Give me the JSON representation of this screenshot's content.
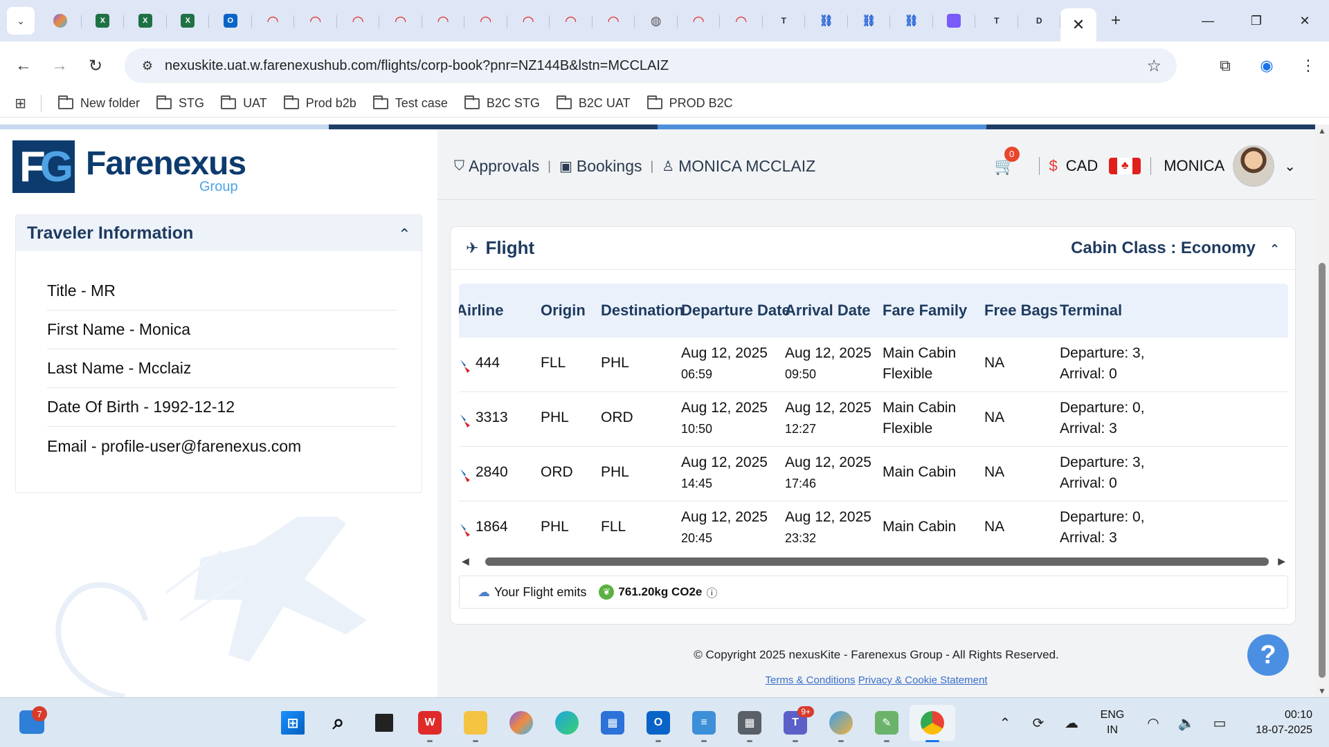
{
  "browser": {
    "tabs": [
      {
        "icon": "copilot-icon",
        "active": false
      },
      {
        "icon": "excel-icon",
        "label": "X",
        "active": false
      },
      {
        "icon": "excel-icon",
        "label": "X",
        "active": false
      },
      {
        "icon": "excel-icon",
        "label": "X",
        "active": false
      },
      {
        "icon": "outlook-icon",
        "label": "O",
        "active": false
      },
      {
        "icon": "arch-icon",
        "active": false
      },
      {
        "icon": "arch-icon",
        "active": false
      },
      {
        "icon": "arch-icon",
        "active": false
      },
      {
        "icon": "arch-icon",
        "active": false
      },
      {
        "icon": "arch-icon",
        "active": false
      },
      {
        "icon": "arch-icon",
        "active": false
      },
      {
        "icon": "arch-icon",
        "active": false
      },
      {
        "icon": "arch-icon",
        "active": false
      },
      {
        "icon": "arch-icon",
        "active": false
      },
      {
        "icon": "globe-icon",
        "active": false
      },
      {
        "icon": "arch-icon",
        "active": false
      },
      {
        "icon": "arch-icon",
        "active": false
      },
      {
        "icon": "t-icon",
        "label": "T",
        "active": false
      },
      {
        "icon": "link-icon",
        "active": false
      },
      {
        "icon": "link-icon",
        "active": false
      },
      {
        "icon": "link-icon",
        "active": false
      },
      {
        "icon": "purple-icon",
        "active": false
      },
      {
        "icon": "t-icon",
        "label": "T",
        "active": false
      },
      {
        "icon": "d-icon",
        "label": "D",
        "active": false
      }
    ],
    "url": "nexuskite.uat.w.farenexushub.com/flights/corp-book?pnr=NZ144B&lstn=MCCLAIZ",
    "bookmarks": [
      "New folder",
      "STG",
      "UAT",
      "Prod b2b",
      "Test case",
      "B2C STG",
      "B2C UAT",
      "PROD B2C"
    ]
  },
  "logo": {
    "mark": "FG",
    "name": "Farenexus",
    "group": "Group"
  },
  "traveler": {
    "title": "Traveler Information",
    "rows": [
      "Title - MR",
      "First Name - Monica",
      "Last Name - Mcclaiz",
      "Date Of Birth - 1992-12-12",
      "Email - profile-user@farenexus.com"
    ]
  },
  "header": {
    "approvals": "Approvals",
    "bookings": "Bookings",
    "traveler_name": "MONICA MCCLAIZ",
    "cart_count": "0",
    "currency_symbol": "$",
    "currency": "CAD",
    "user": "MONICA"
  },
  "flight": {
    "title": "Flight",
    "cabin": "Cabin Class : Economy",
    "columns": [
      "Airline",
      "Origin",
      "Destination",
      "Departure Date",
      "Arrival Date",
      "Fare Family",
      "Free Bags",
      "Terminal"
    ],
    "rows": [
      {
        "flight": "444",
        "origin": "FLL",
        "destination": "PHL",
        "dep_date": "Aug 12, 2025",
        "dep_time": "06:59",
        "arr_date": "Aug 12, 2025",
        "arr_time": "09:50",
        "fare1": "Main Cabin",
        "fare2": "Flexible",
        "bags": "NA",
        "term1": "Departure: 3,",
        "term2": "Arrival: 0"
      },
      {
        "flight": "3313",
        "origin": "PHL",
        "destination": "ORD",
        "dep_date": "Aug 12, 2025",
        "dep_time": "10:50",
        "arr_date": "Aug 12, 2025",
        "arr_time": "12:27",
        "fare1": "Main Cabin",
        "fare2": "Flexible",
        "bags": "NA",
        "term1": "Departure: 0,",
        "term2": "Arrival: 3"
      },
      {
        "flight": "2840",
        "origin": "ORD",
        "destination": "PHL",
        "dep_date": "Aug 12, 2025",
        "dep_time": "14:45",
        "arr_date": "Aug 12, 2025",
        "arr_time": "17:46",
        "fare1": "Main Cabin",
        "fare2": "",
        "bags": "NA",
        "term1": "Departure: 3,",
        "term2": "Arrival: 0"
      },
      {
        "flight": "1864",
        "origin": "PHL",
        "destination": "FLL",
        "dep_date": "Aug 12, 2025",
        "dep_time": "20:45",
        "arr_date": "Aug 12, 2025",
        "arr_time": "23:32",
        "fare1": "Main Cabin",
        "fare2": "",
        "bags": "NA",
        "term1": "Departure: 0,",
        "term2": "Arrival: 3"
      }
    ],
    "emits_label": "Your Flight emits",
    "emits_value": "761.20kg CO2e"
  },
  "footer": {
    "copyright": "© Copyright 2025 nexusKite - Farenexus Group - All Rights Reserved.",
    "terms": "Terms & Conditions",
    "privacy": "Privacy & Cookie Statement"
  },
  "taskbar": {
    "widget_badge": "7",
    "teams_badge": "9+",
    "lang1": "ENG",
    "lang2": "IN",
    "time": "00:10",
    "date": "18-07-2025"
  },
  "colors": {
    "brand_navy": "#0d3b6e",
    "brand_blue": "#4ea3e4",
    "heading": "#1e3a5f",
    "link": "#3b6fc9",
    "help_button": "#4b8fe2"
  }
}
